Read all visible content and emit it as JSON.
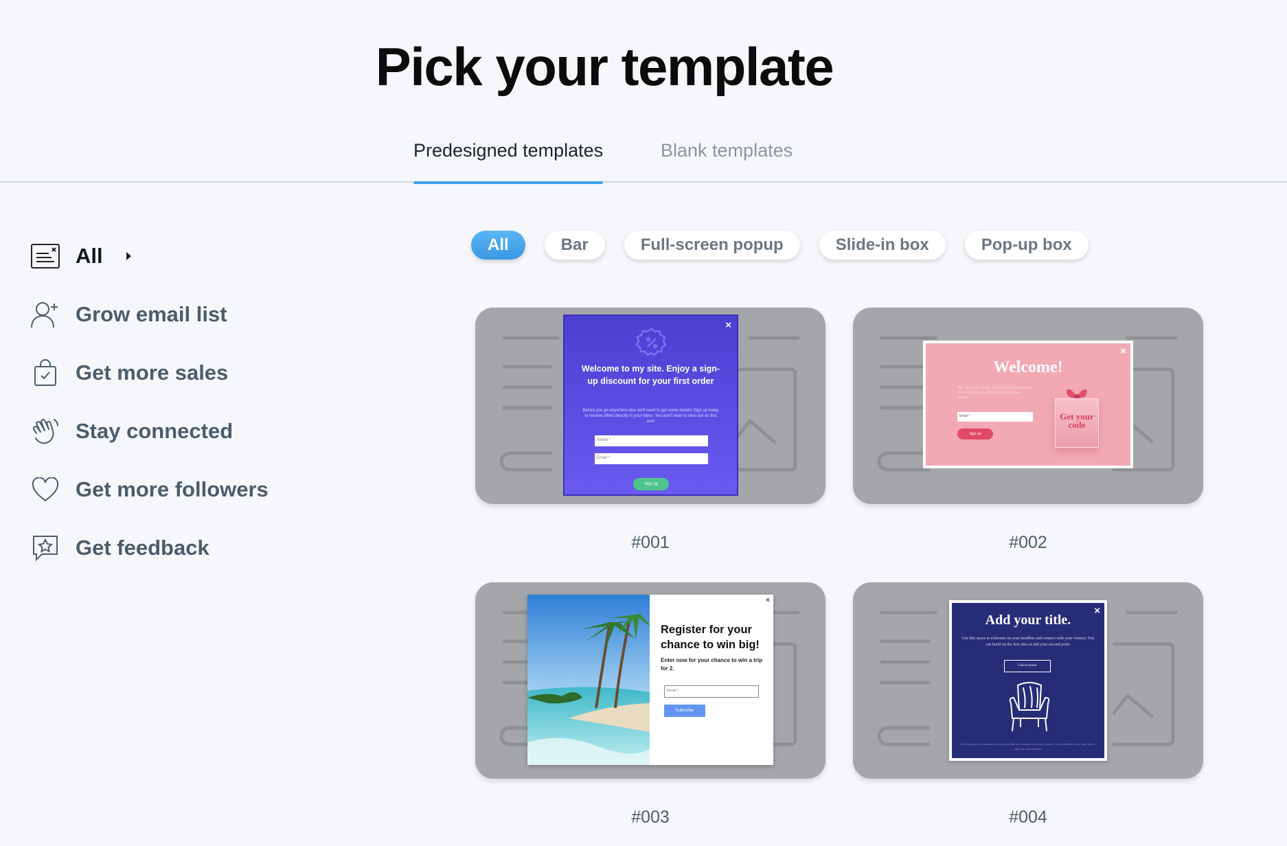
{
  "page_title": "Pick your template",
  "tabs": [
    {
      "label": "Predesigned templates",
      "active": true
    },
    {
      "label": "Blank templates",
      "active": false
    }
  ],
  "sidebar": {
    "items": [
      {
        "label": "All",
        "icon": "popup-window-icon",
        "active": true
      },
      {
        "label": "Grow email list",
        "icon": "add-user-icon"
      },
      {
        "label": "Get more sales",
        "icon": "shopping-bag-icon"
      },
      {
        "label": "Stay connected",
        "icon": "waving-hand-icon"
      },
      {
        "label": "Get more followers",
        "icon": "heart-icon"
      },
      {
        "label": "Get feedback",
        "icon": "star-speech-bubble-icon"
      }
    ]
  },
  "filters": [
    {
      "label": "All",
      "active": true
    },
    {
      "label": "Bar"
    },
    {
      "label": "Full-screen popup"
    },
    {
      "label": "Slide-in box"
    },
    {
      "label": "Pop-up box"
    }
  ],
  "colors": {
    "accent": "#3ba2ea",
    "card_bg": "#a4a6a9",
    "page_bg": "#f5f7fa"
  },
  "templates": [
    {
      "id": "#001",
      "popup": {
        "title": "Welcome to my site. Enjoy a sign-up discount for your first order",
        "body": "Before you go anywhere else we'll need to get some details! Sign up today to receive offers directly in your inbox. You won't want to miss out on this one!",
        "name_placeholder": "Name *",
        "email_placeholder": "Email *",
        "button": "Sign up",
        "close": "×"
      }
    },
    {
      "id": "#002",
      "popup": {
        "title": "Welcome!",
        "body": "Sign up to our mailing list to get exclusive access to newsletters only offers and pre-release content.",
        "email_placeholder": "Email *",
        "button": "Sign up",
        "gift_text": "Get your code",
        "close": "×"
      }
    },
    {
      "id": "#003",
      "popup": {
        "title": "Register for your chance to win big!",
        "subtitle": "Enter now for your chance to win a trip for 2.",
        "email_placeholder": "Email *",
        "button": "Subscribe",
        "close": "×"
      }
    },
    {
      "id": "#004",
      "popup": {
        "title": "Add your title.",
        "body": "Use this space to elaborate on your headline and connect with your visitors. You can build on the first idea or add your second point.",
        "button": "Call to action",
        "footer": "Use this space to elaborate on your headline and connect with your visitors. You can build on the first idea or add your second point.",
        "close": "×"
      }
    }
  ]
}
